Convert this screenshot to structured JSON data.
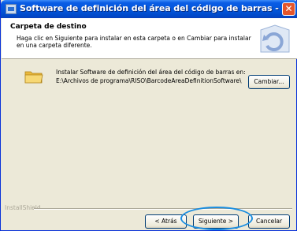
{
  "window": {
    "title": "Software de definición del área del código de barras - InstallShield Wi...",
    "close_symbol": "✕"
  },
  "header": {
    "title": "Carpeta de destino",
    "description": "Haga clic en Siguiente para instalar en esta carpeta o en Cambiar para instalar en una carpeta diferente."
  },
  "destination": {
    "label": "Instalar Software de definición del área del código de barras en:",
    "path": "E:\\Archivos de programa\\RISO\\BarcodeAreaDefinitionSoftware\\",
    "change_button": "Cambiar...",
    "icon": "folder-icon"
  },
  "footer": {
    "brand": "InstallShield",
    "back_button": "< Atrás",
    "next_button": "Siguiente >",
    "cancel_button": "Cancelar"
  },
  "colors": {
    "titlebar": "#0054e3",
    "highlight": "#1b8ee0",
    "folder": "#f5d26a"
  }
}
